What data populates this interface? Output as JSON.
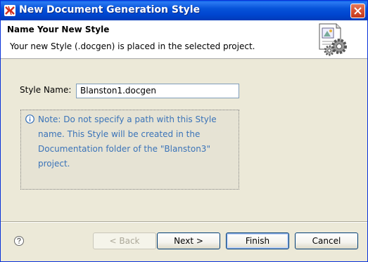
{
  "window": {
    "title": "New Document Generation Style",
    "title_color": "#0a4fd6"
  },
  "banner": {
    "title": "Name Your New Style",
    "subtitle": "Your new Style (.docgen) is placed in the selected project."
  },
  "form": {
    "style_name_label": "Style Name:",
    "style_name_value": "Blanston1.docgen"
  },
  "note": {
    "icon": "info-icon",
    "text": "Note: Do not specify a path with this Style name. This Style will be created in the Documentation folder of the \"Blanston3\" project.",
    "color": "#3a73b8"
  },
  "buttons": {
    "back": "< Back",
    "next": "Next >",
    "finish": "Finish",
    "cancel": "Cancel",
    "help_icon": "help-icon"
  }
}
